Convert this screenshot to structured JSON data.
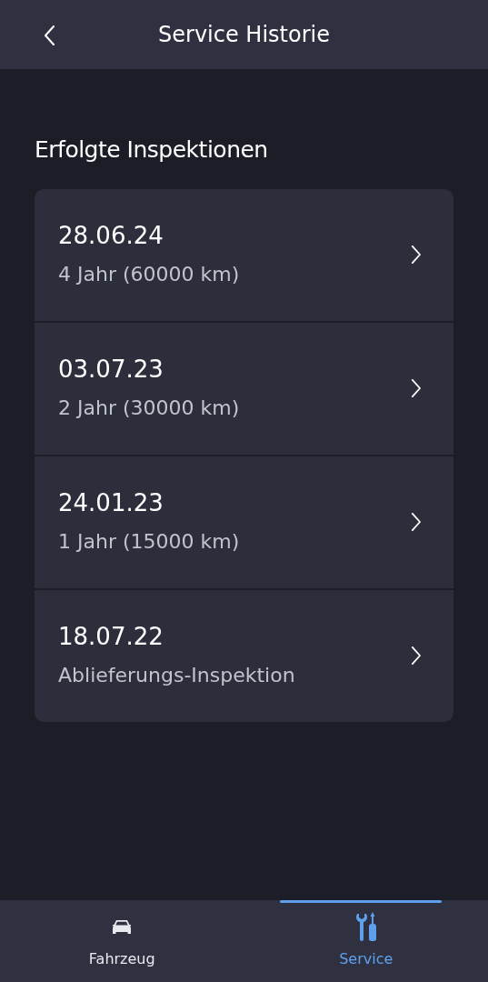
{
  "header": {
    "title": "Service Historie"
  },
  "section_title": "Erfolgte Inspektionen",
  "inspections": [
    {
      "date": "28.06.24",
      "description": "4 Jahr (60000 km)"
    },
    {
      "date": "03.07.23",
      "description": "2 Jahr (30000 km)"
    },
    {
      "date": "24.01.23",
      "description": "1 Jahr (15000 km)"
    },
    {
      "date": "18.07.22",
      "description": "Ablieferungs-Inspektion"
    }
  ],
  "tabs": [
    {
      "label": "Fahrzeug",
      "kind": "car",
      "selected": false
    },
    {
      "label": "Service",
      "kind": "tools",
      "selected": true
    }
  ]
}
